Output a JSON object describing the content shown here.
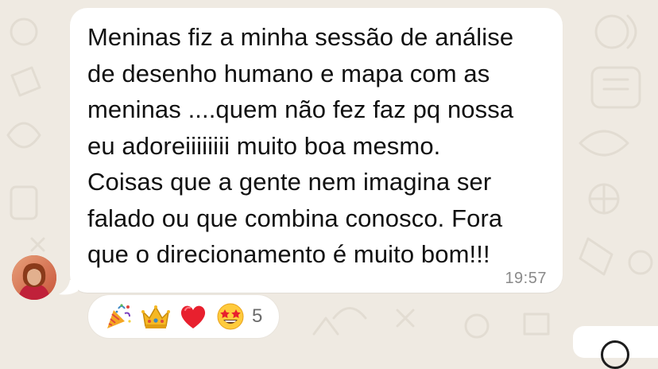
{
  "message": {
    "text": "Meninas fiz a minha sessão de análise\nde desenho humano e mapa com as\nmeninas ....quem não fez faz pq nossa\neu adoreiiiiiiii muito boa mesmo.\nCoisas que a gente nem imagina ser\nfalado ou que combina conosco. Fora\nque o direcionamento é muito bom!!!",
    "time": "19:57"
  },
  "reactions": {
    "emojis": [
      "party-popper",
      "crown",
      "red-heart",
      "star-struck-face"
    ],
    "count": "5"
  },
  "colors": {
    "chat_background": "#efeae2",
    "bubble": "#ffffff",
    "text": "#111111",
    "timestamp": "#8a8a8a"
  }
}
